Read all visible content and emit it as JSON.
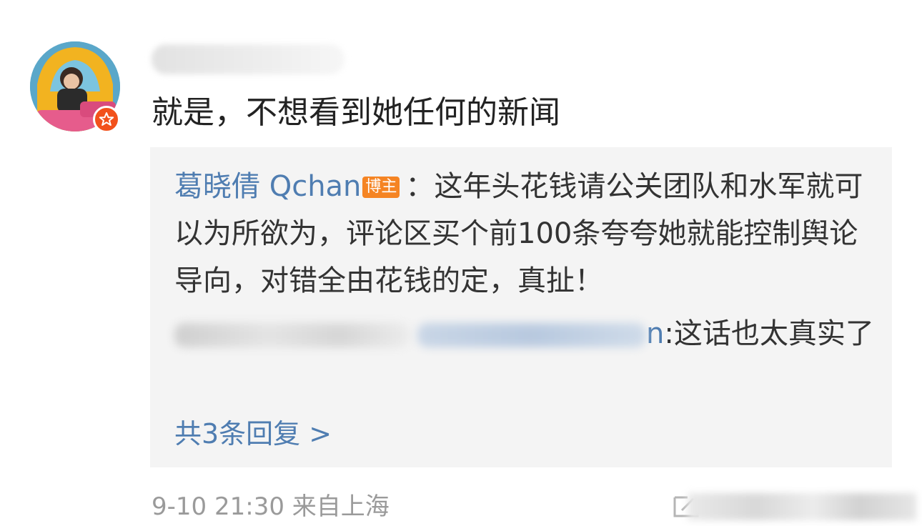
{
  "comment": {
    "text": "就是，不想看到她任何的新闻",
    "meta_time": "9-10 21:30",
    "meta_source": "来自上海"
  },
  "replies": {
    "first": {
      "author": "葛晓倩 Qchan",
      "badge": "博主",
      "separator": "：",
      "text": "这年头花钱请公关团队和水军就可以为所欲为，评论区买个前100条夸夸她就能控制舆论导向，对错全由花钱的定，真扯！"
    },
    "second": {
      "name_tail": "n",
      "text": ":这话也太真实了"
    },
    "more_label": "共3条回复 >"
  },
  "colors": {
    "link_blue": "#4f7db1",
    "badge_orange": "#f58423",
    "verified_red": "#f2511b",
    "reply_bg": "#f4f4f4"
  },
  "icons": [
    "verified-star-icon",
    "share-icon"
  ]
}
